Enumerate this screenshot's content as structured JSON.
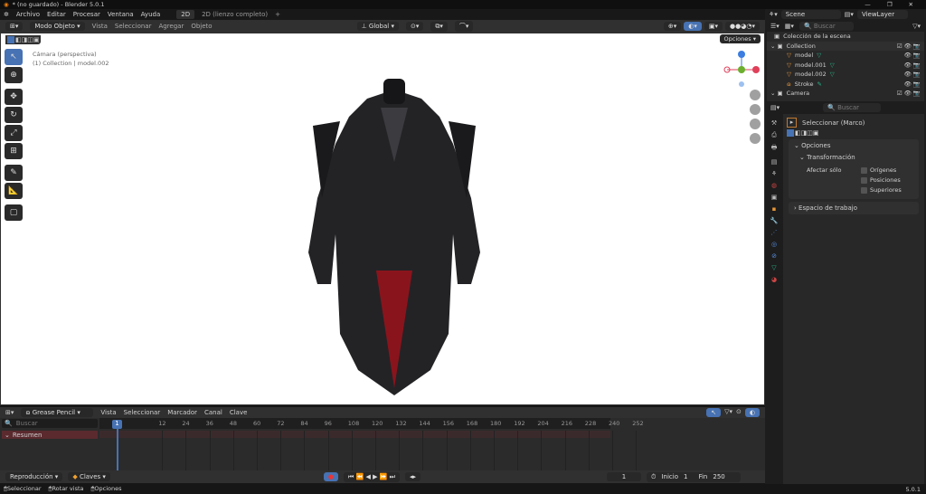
{
  "window": {
    "title": "* (no guardado) - Blender 5.0.1",
    "minimize": "—",
    "maximize": "❐",
    "close": "✕"
  },
  "menu": [
    "Archivo",
    "Editar",
    "Procesar",
    "Ventana",
    "Ayuda"
  ],
  "workspaces": [
    "2D",
    "2D (lienzo completo)",
    "+"
  ],
  "viewport": {
    "mode": "Modo Objeto",
    "menus": [
      "Vista",
      "Seleccionar",
      "Agregar",
      "Objeto"
    ],
    "orientation": "Global",
    "options": "Opciones",
    "camera_label": "Cámara (perspectiva)",
    "collection_label": "(1) Collection | model.002"
  },
  "topright": {
    "scene": "Scene",
    "view_layer": "ViewLayer"
  },
  "outliner": {
    "search_placeholder": "Buscar",
    "root": "Colección de la escena",
    "items": [
      {
        "name": "Collection"
      },
      {
        "name": "model"
      },
      {
        "name": "model.001"
      },
      {
        "name": "model.002"
      },
      {
        "name": "Stroke"
      },
      {
        "name": "Camera"
      }
    ]
  },
  "properties": {
    "search_placeholder": "Buscar",
    "tool_name": "Seleccionar (Marco)",
    "section_options": "Opciones",
    "section_transform": "Transformación",
    "affect_only": "Afectar sólo",
    "checkboxes": [
      "Orígenes",
      "Posiciones",
      "Superiores"
    ],
    "section_workspace": "Espacio de trabajo"
  },
  "timeline": {
    "mode": "Grease Pencil",
    "menus": [
      "Vista",
      "Seleccionar",
      "Marcador",
      "Canal",
      "Clave"
    ],
    "search_placeholder": "Buscar",
    "summary": "Resumen",
    "current_frame": "1",
    "ticks": [
      "12",
      "24",
      "36",
      "48",
      "60",
      "72",
      "84",
      "96",
      "108",
      "120",
      "132",
      "144",
      "156",
      "168",
      "180",
      "192",
      "204",
      "216",
      "228",
      "240",
      "252"
    ]
  },
  "playback": {
    "menu": "Reproducción",
    "keys": "Claves",
    "frame": "1",
    "start_label": "Inicio",
    "start": "1",
    "end_label": "Fin",
    "end": "250"
  },
  "status": {
    "items": [
      "Seleccionar",
      "Rotar vista",
      "Opciones"
    ],
    "version": "5.0.1"
  },
  "colors": {
    "accent": "#4772b3",
    "summary": "#5a2a2f"
  }
}
